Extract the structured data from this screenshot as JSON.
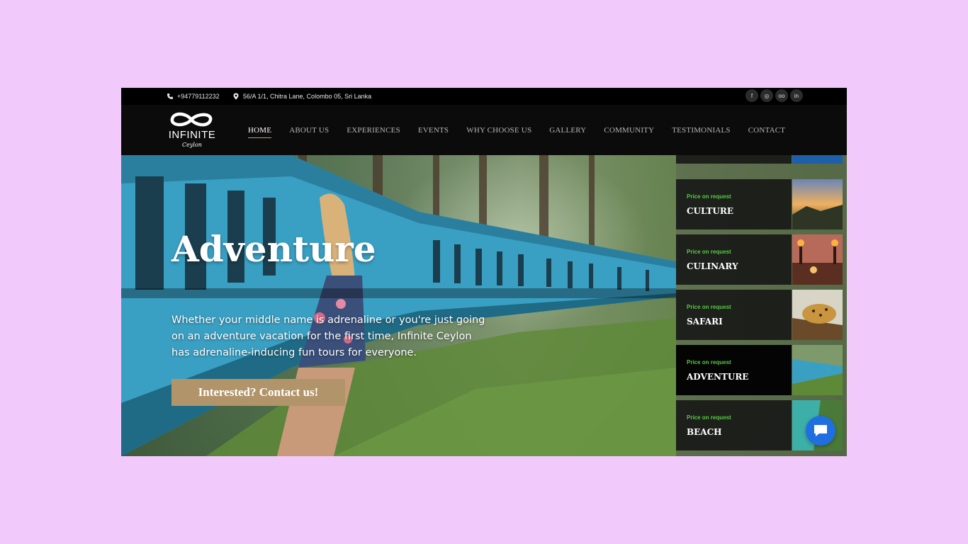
{
  "topbar": {
    "phone": "+94779112232",
    "address": "56/A 1/1, Chitra Lane, Colombo 05, Sri Lanka",
    "socials": [
      {
        "name": "facebook",
        "glyph": "f"
      },
      {
        "name": "instagram",
        "glyph": "◎"
      },
      {
        "name": "tripadvisor",
        "glyph": "oo"
      },
      {
        "name": "linkedin",
        "glyph": "in"
      }
    ]
  },
  "logo": {
    "main": "INFINITE",
    "sub": "Ceylon"
  },
  "nav": {
    "items": [
      "HOME",
      "ABOUT US",
      "EXPERIENCES",
      "EVENTS",
      "WHY CHOOSE US",
      "GALLERY",
      "COMMUNITY",
      "TESTIMONIALS",
      "CONTACT"
    ],
    "active": "HOME"
  },
  "hero": {
    "title": "Adventure",
    "text": "Whether your middle name is adrenaline or you're just going on an adventure vacation for the first time, Infinite Ceylon has adrenaline-inducing fun tours for everyone.",
    "button": "Interested? Contact us!"
  },
  "tours": [
    {
      "price": "Price on request",
      "name": "CULTURE"
    },
    {
      "price": "Price on request",
      "name": "CULINARY"
    },
    {
      "price": "Price on request",
      "name": "SAFARI"
    },
    {
      "price": "Price on request",
      "name": "ADVENTURE"
    },
    {
      "price": "Price on request",
      "name": "BEACH"
    }
  ],
  "colors": {
    "accent": "#b2946a",
    "price": "#56c943",
    "chat": "#1f6fe0"
  }
}
